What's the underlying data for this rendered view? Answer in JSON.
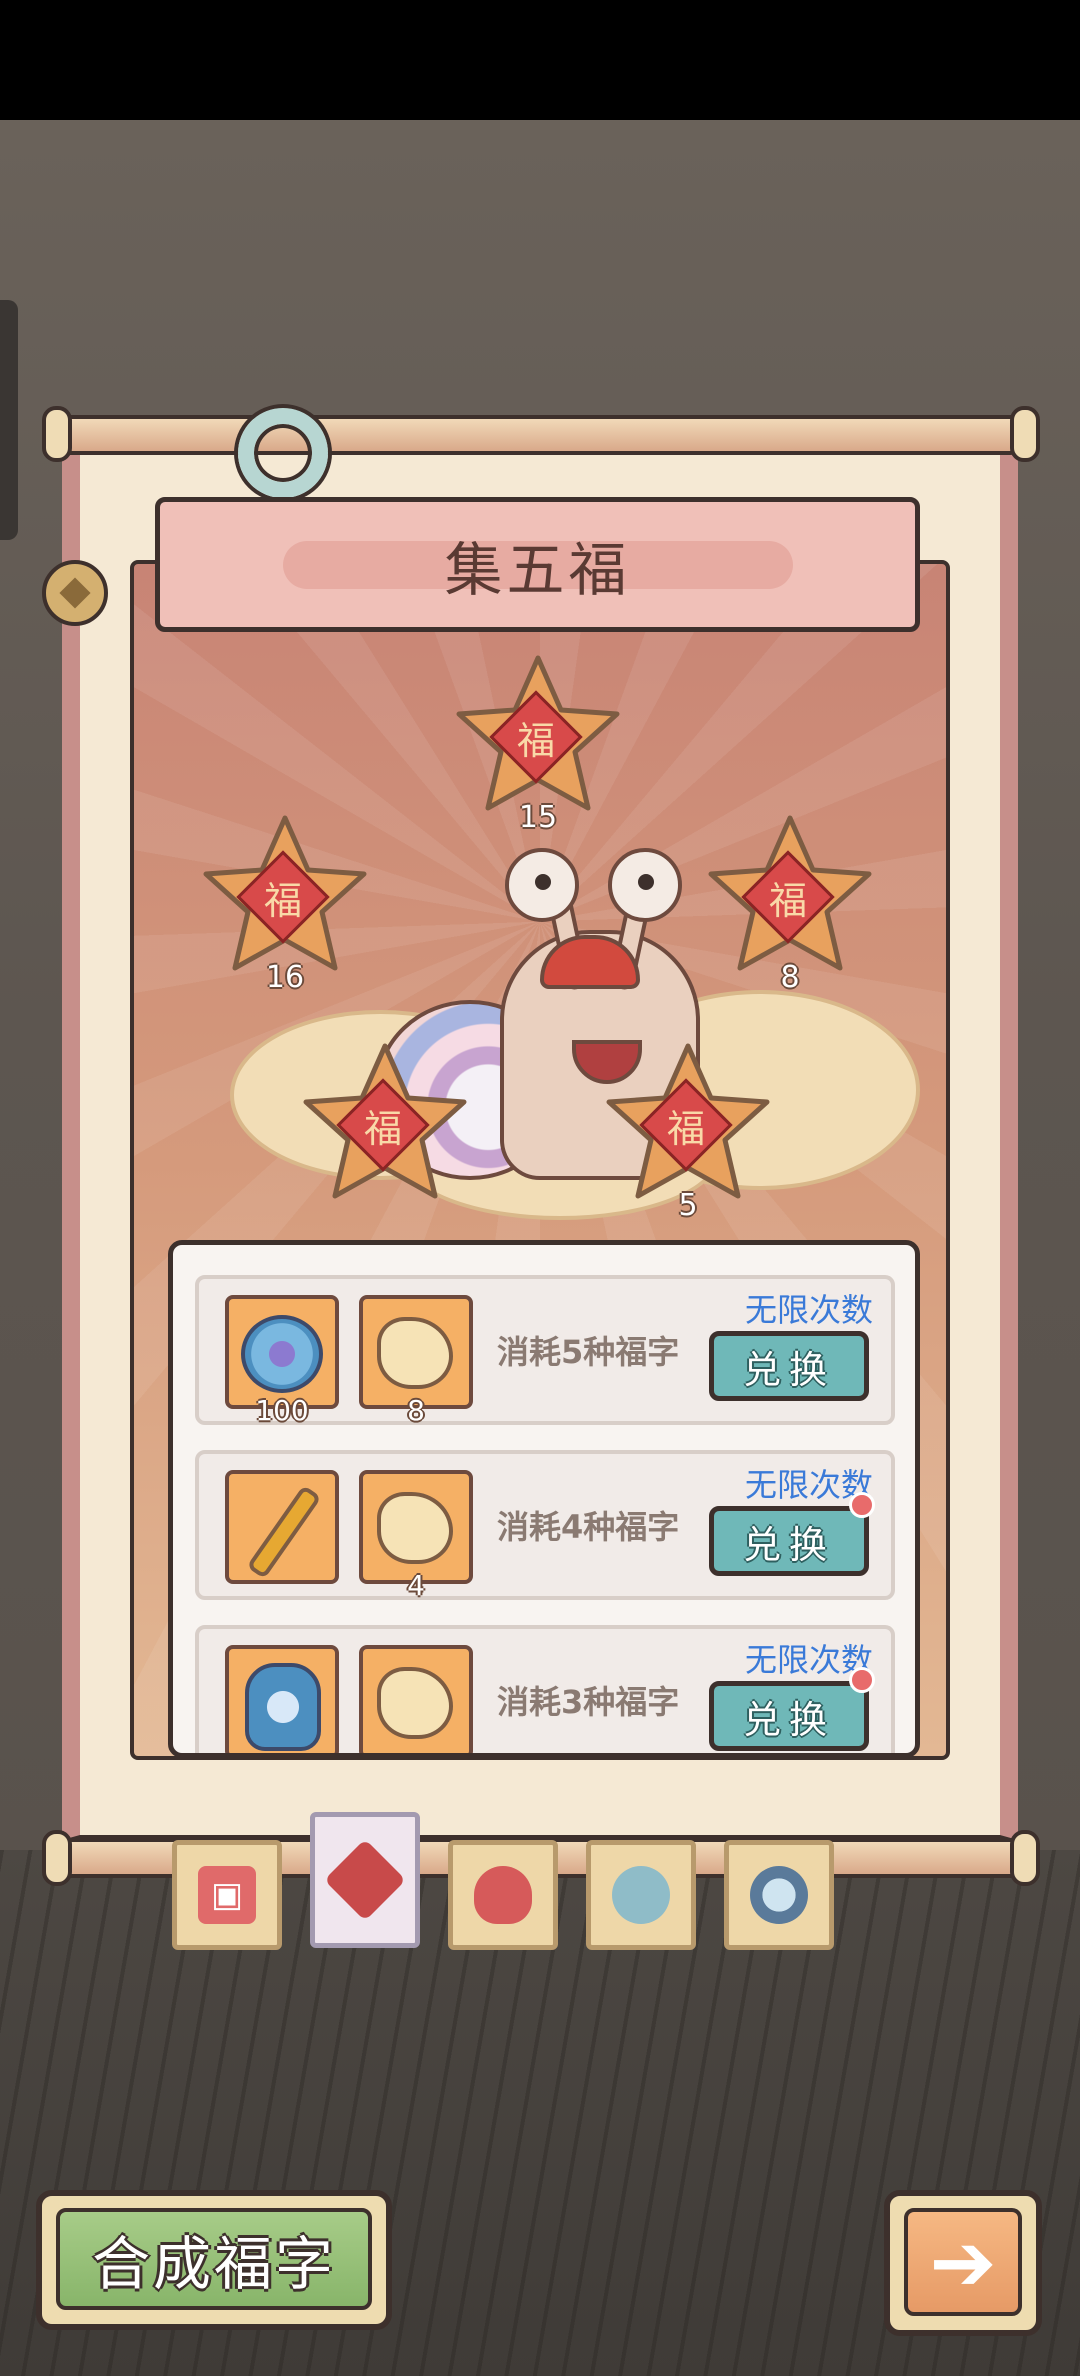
{
  "title": "集五福",
  "stars": [
    {
      "char": "福",
      "count": "15"
    },
    {
      "char": "福",
      "count": "16"
    },
    {
      "char": "福",
      "count": "8"
    },
    {
      "char": "福",
      "count": ""
    },
    {
      "char": "福",
      "count": "5"
    }
  ],
  "rewards": [
    {
      "items": [
        {
          "icon": "gem-icon",
          "qty": "100"
        },
        {
          "icon": "dumpling-icon",
          "qty": "8"
        }
      ],
      "cost": "消耗5种福字",
      "limit": "无限次数",
      "button": "兑换",
      "notify": false
    },
    {
      "items": [
        {
          "icon": "firework-icon",
          "qty": ""
        },
        {
          "icon": "dumpling-icon",
          "qty": "4"
        }
      ],
      "cost": "消耗4种福字",
      "limit": "无限次数",
      "button": "兑换",
      "notify": true
    },
    {
      "items": [
        {
          "icon": "jar-icon",
          "qty": ""
        },
        {
          "icon": "dumpling-icon",
          "qty": ""
        }
      ],
      "cost": "消耗3种福字",
      "limit": "无限次数",
      "button": "兑换",
      "notify": true
    }
  ],
  "tabs": [
    {
      "icon": "red-envelope-icon",
      "active": false
    },
    {
      "icon": "fu-tab-icon",
      "active": true
    },
    {
      "icon": "lucky-bag-icon",
      "active": false
    },
    {
      "icon": "lantern-icon",
      "active": false
    },
    {
      "icon": "orb-icon",
      "active": false
    }
  ],
  "merge_button": "合成福字",
  "colors": {
    "accent_blue": "#3a7ad8",
    "button_teal": "#6fb8b8",
    "merge_green": "#88b56a"
  }
}
